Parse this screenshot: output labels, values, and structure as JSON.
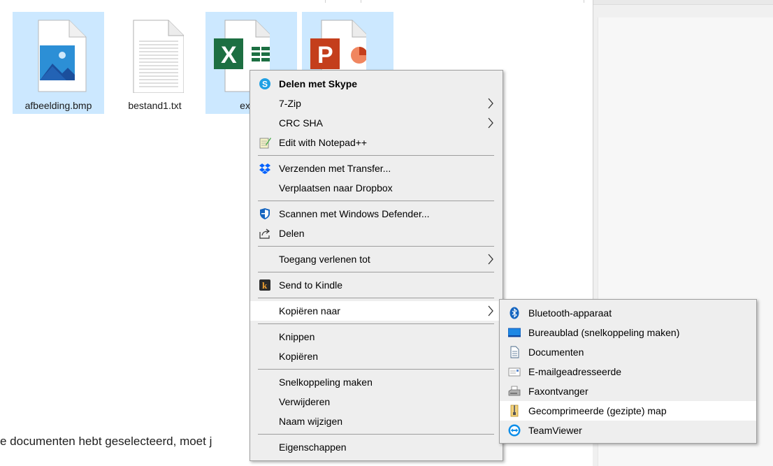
{
  "files": [
    {
      "label": "afbeelding.bmp",
      "selected": true
    },
    {
      "label": "bestand1.txt",
      "selected": false
    },
    {
      "label": "excel",
      "selected": true
    },
    {
      "label": "",
      "selected": true
    }
  ],
  "background_text": "e documenten hebt geselecteerd, moet j",
  "context_menu": {
    "items": [
      {
        "label": "Delen met Skype",
        "icon": "skype-icon"
      },
      {
        "label": "7-Zip",
        "submenu": true
      },
      {
        "label": "CRC SHA",
        "submenu": true
      },
      {
        "label": "Edit with Notepad++",
        "icon": "notepad-icon"
      },
      {
        "label": "Verzenden met Transfer...",
        "icon": "dropbox-icon"
      },
      {
        "label": "Verplaatsen naar Dropbox"
      },
      {
        "label": "Scannen met Windows Defender...",
        "icon": "defender-shield-icon"
      },
      {
        "label": "Delen",
        "icon": "share-icon"
      },
      {
        "label": "Toegang verlenen tot",
        "submenu": true
      },
      {
        "label": "Send to Kindle",
        "icon": "kindle-icon"
      },
      {
        "label": "Kopiëren naar",
        "submenu": true,
        "highlighted": true
      },
      {
        "label": "Knippen"
      },
      {
        "label": "Kopiëren"
      },
      {
        "label": "Snelkoppeling maken"
      },
      {
        "label": "Verwijderen"
      },
      {
        "label": "Naam wijzigen"
      },
      {
        "label": "Eigenschappen"
      }
    ]
  },
  "submenu": {
    "items": [
      {
        "label": "Bluetooth-apparaat",
        "icon": "bluetooth-icon"
      },
      {
        "label": "Bureaublad (snelkoppeling maken)",
        "icon": "desktop-icon"
      },
      {
        "label": "Documenten",
        "icon": "documents-icon"
      },
      {
        "label": "E-mailgeadresseerde",
        "icon": "mail-icon"
      },
      {
        "label": "Faxontvanger",
        "icon": "fax-icon"
      },
      {
        "label": "Gecomprimeerde (gezipte) map",
        "icon": "zip-folder-icon",
        "highlighted": true
      },
      {
        "label": "TeamViewer",
        "icon": "teamviewer-icon"
      }
    ]
  },
  "colors": {
    "selection": "#cce8ff",
    "menu_bg": "#eeeeee",
    "menu_hover": "#ffffff",
    "excel_green": "#1d6f42",
    "ppt_red": "#c43e1c"
  }
}
